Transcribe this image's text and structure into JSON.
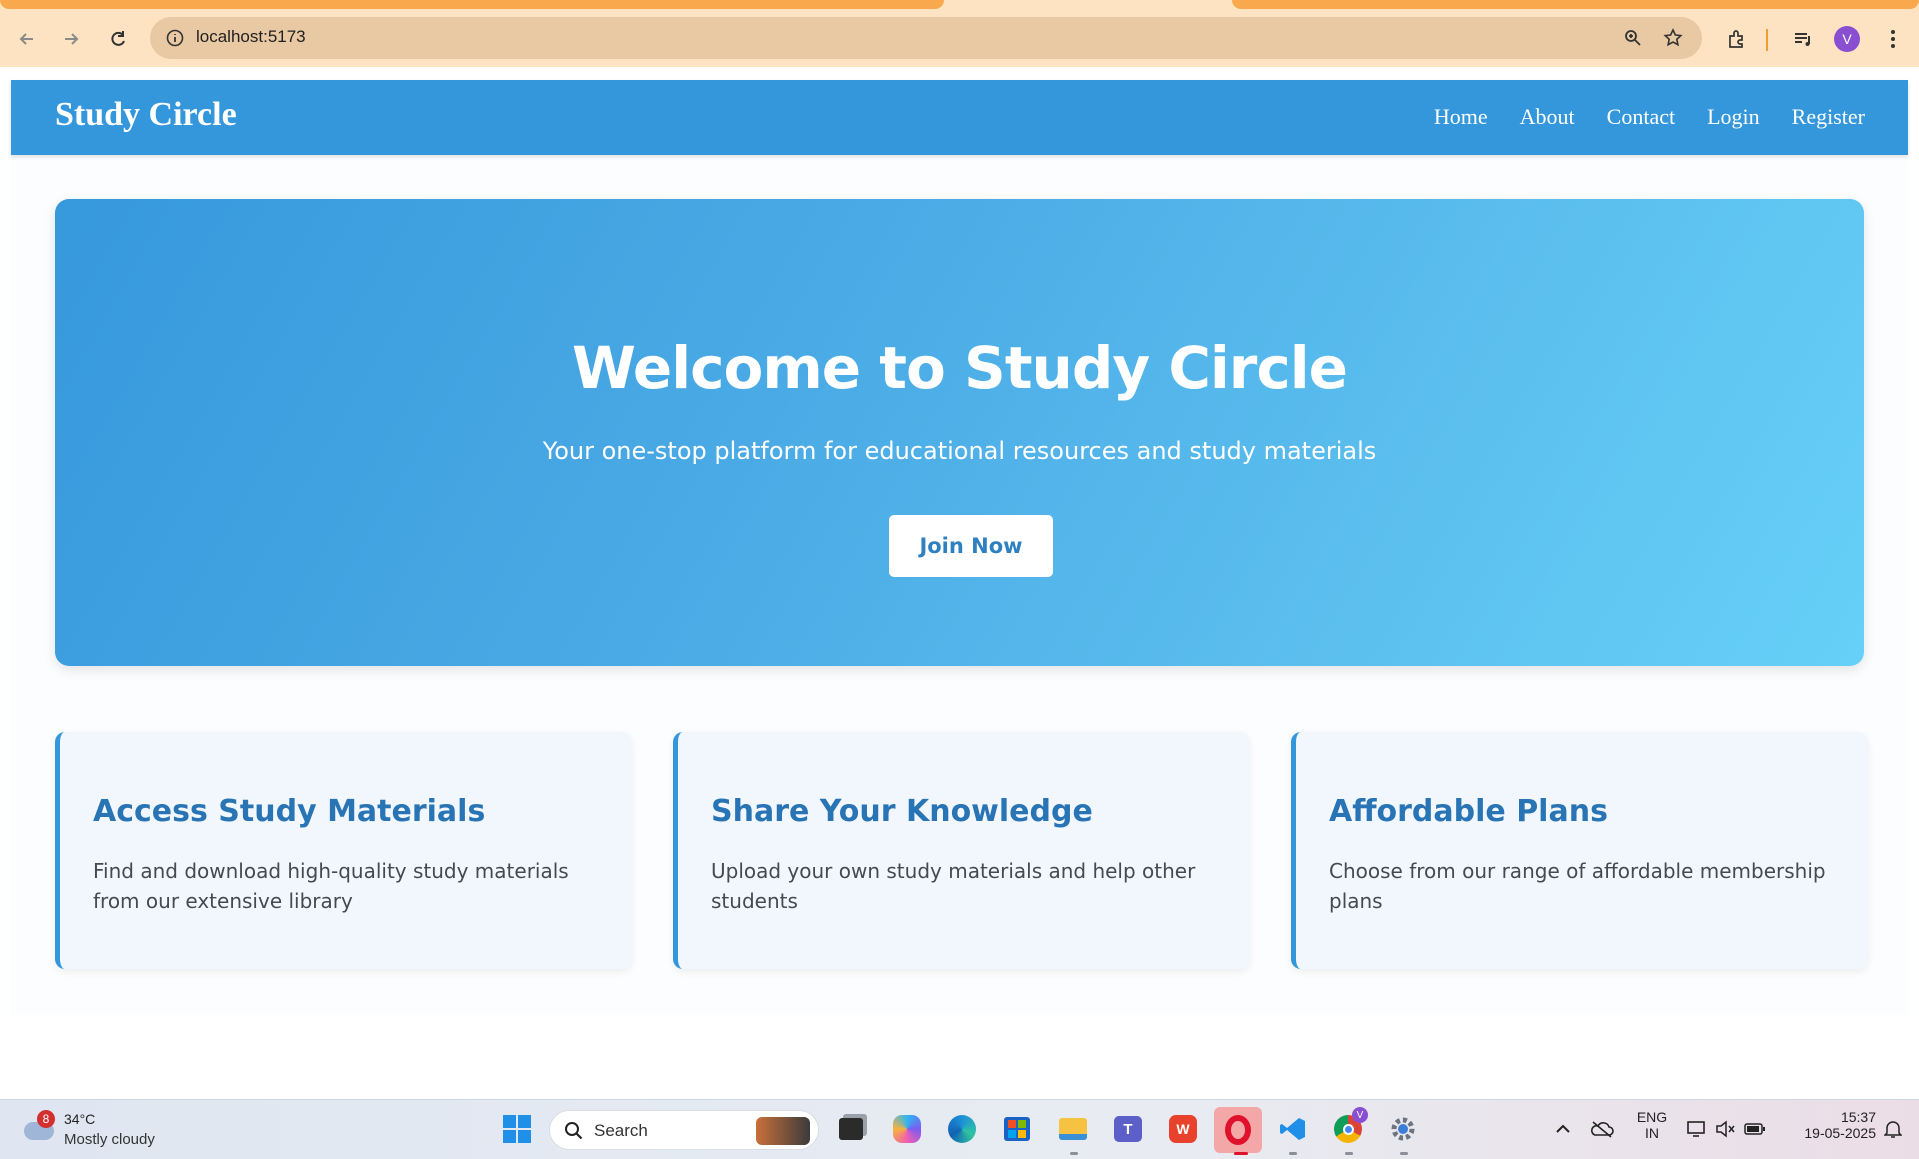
{
  "browser": {
    "url": "localhost:5173",
    "profile_initial": "V",
    "icons": [
      "back-icon",
      "forward-icon",
      "reload-icon",
      "site-info-icon",
      "zoom-icon",
      "star-icon",
      "extensions-icon",
      "media-icon",
      "menu-icon"
    ]
  },
  "site": {
    "brand": "Study Circle",
    "nav": [
      "Home",
      "About",
      "Contact",
      "Login",
      "Register"
    ],
    "accent": "#3497db"
  },
  "hero": {
    "title": "Welcome to Study Circle",
    "subtitle": "Your one-stop platform for educational resources and study materials",
    "cta": "Join Now"
  },
  "features": [
    {
      "title": "Access Study Materials",
      "text": "Find and download high-quality study materials from our extensive library"
    },
    {
      "title": "Share Your Knowledge",
      "text": "Upload your own study materials and help other students"
    },
    {
      "title": "Affordable Plans",
      "text": "Choose from our range of affordable membership plans"
    }
  ],
  "taskbar": {
    "weather_badge": "8",
    "temperature": "34°C",
    "condition": "Mostly cloudy",
    "search_label": "Search",
    "language": "ENG",
    "region": "IN",
    "time": "15:37",
    "date": "19-05-2025",
    "chrome_badge": "V"
  }
}
